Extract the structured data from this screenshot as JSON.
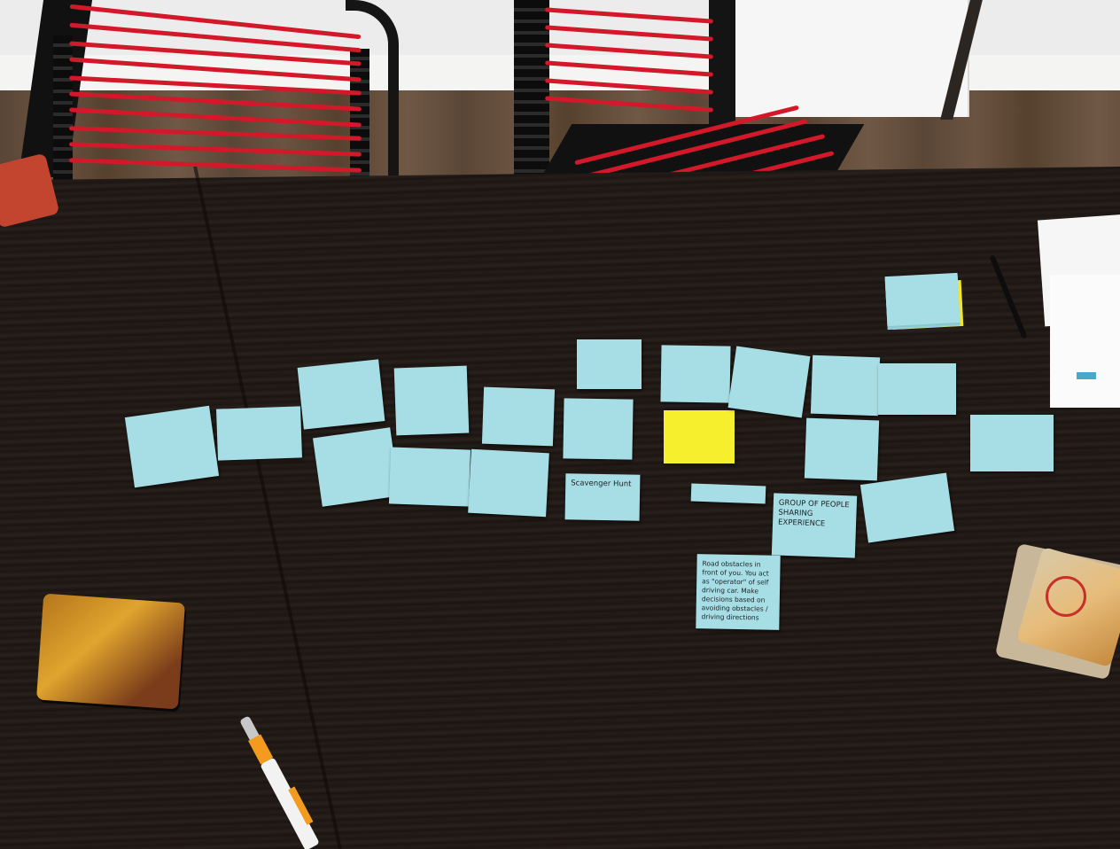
{
  "notes": {
    "scavenger_hunt": "Scavenger Hunt",
    "group_of_people": "GROUP OF PEOPLE SHARING EXPERIENCE",
    "road_obstacles": "Road obstacles in front of you. You act as \"operator\" of self driving car. Make decisions based on avoiding obstacles / driving directions"
  },
  "colors": {
    "note_blue": "#a7dde4",
    "note_yellow": "#f5ef2e",
    "chair_band": "#d3182a",
    "table": "#1e1714"
  }
}
